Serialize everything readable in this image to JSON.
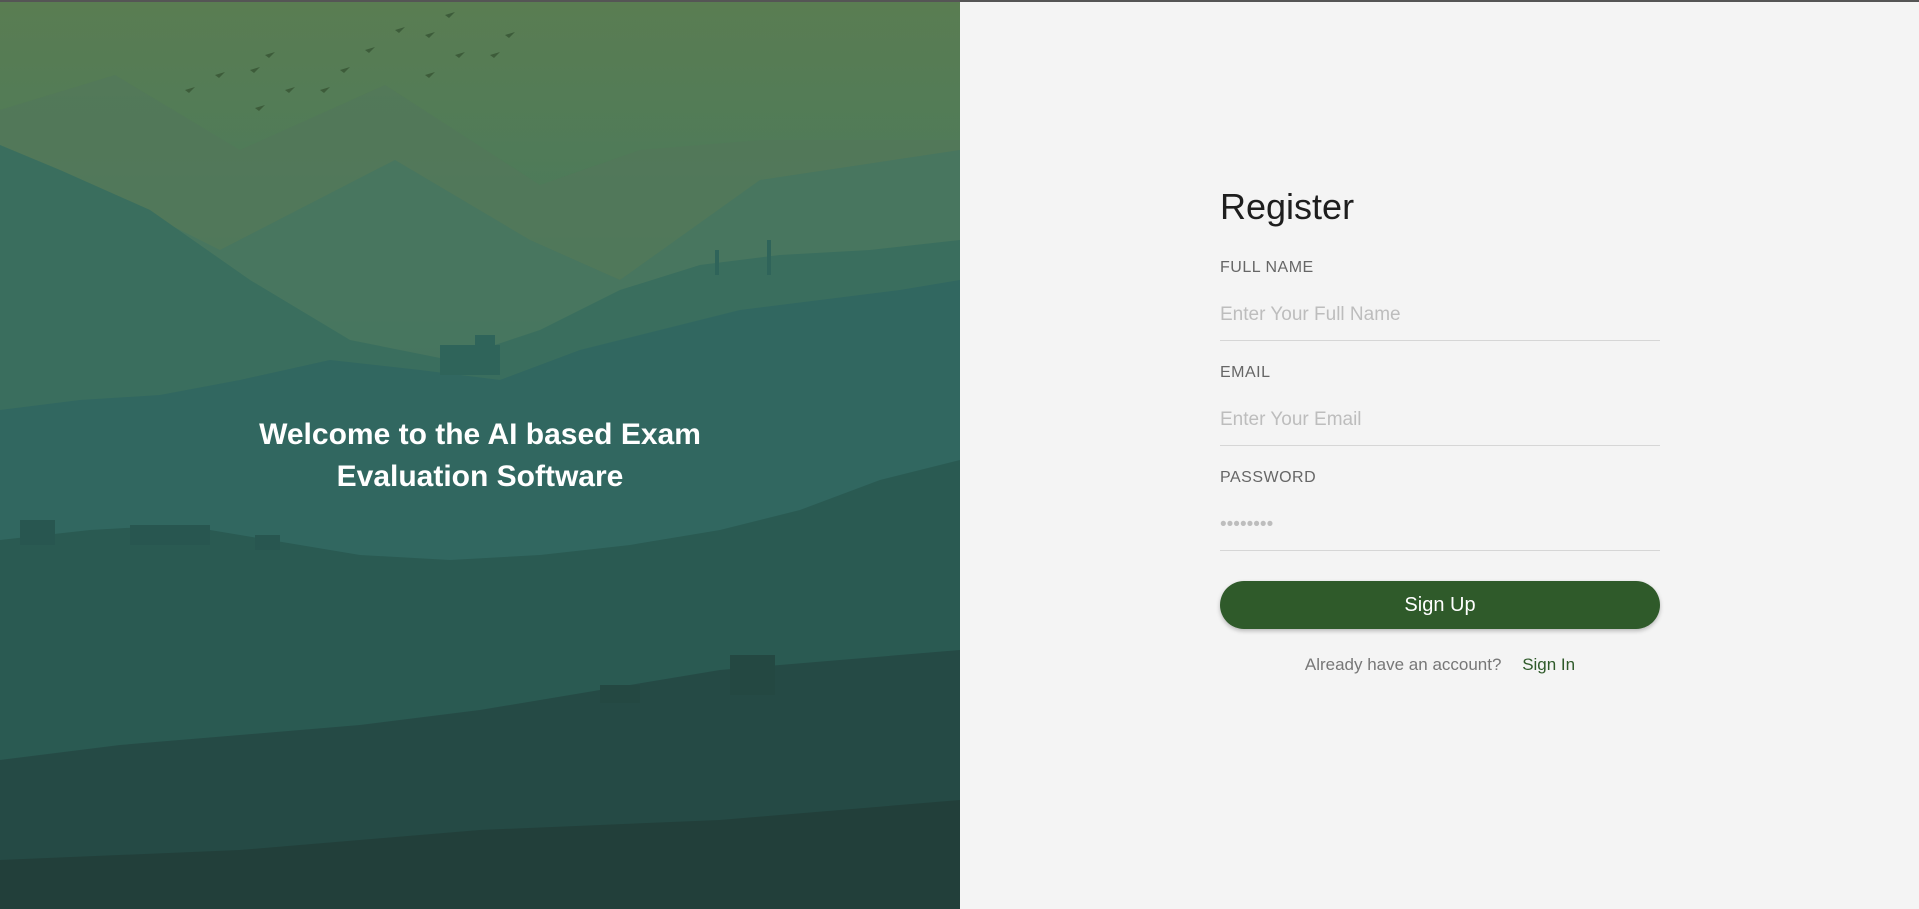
{
  "hero": {
    "welcome_line1": "Welcome to the AI based Exam",
    "welcome_line2": "Evaluation Software"
  },
  "form": {
    "title": "Register",
    "fields": [
      {
        "label": "FULL NAME",
        "placeholder": "Enter Your Full Name",
        "type": "text"
      },
      {
        "label": "EMAIL",
        "placeholder": "Enter Your Email",
        "type": "email"
      },
      {
        "label": "PASSWORD",
        "placeholder": "••••••••",
        "type": "password"
      }
    ],
    "submit_label": "Sign Up",
    "alt_prompt": "Already have an account?",
    "alt_link": "Sign In"
  },
  "colors": {
    "accent": "#2f5a2a",
    "background": "#f4f4f4"
  }
}
